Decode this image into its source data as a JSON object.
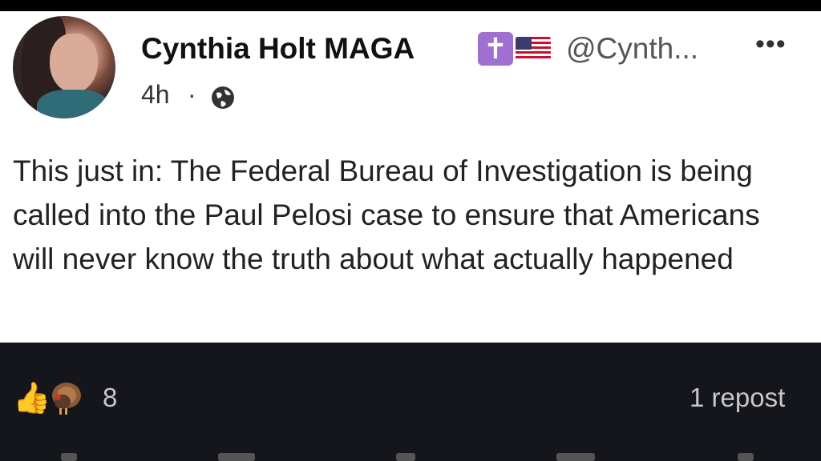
{
  "post": {
    "author_name": "Cynthia Holt MAGA",
    "handle": "@Cynth...",
    "badges": [
      "cross-icon",
      "us-flag-icon"
    ],
    "time": "4h",
    "separator": "·",
    "visibility_icon": "globe-icon",
    "text": "This just in: The Federal Bureau of Investigation is being called into the Paul Pelosi case to ensure that Americans will never know the truth about what actually happened",
    "more_icon": "more-options-icon"
  },
  "engagement": {
    "reaction_icons": [
      "thumbs-up-icon",
      "turkey-icon"
    ],
    "reaction_count": "8",
    "reposts": "1 repost"
  },
  "colors": {
    "badge_purple": "#a070d0",
    "footer_bg": "#14161b"
  }
}
